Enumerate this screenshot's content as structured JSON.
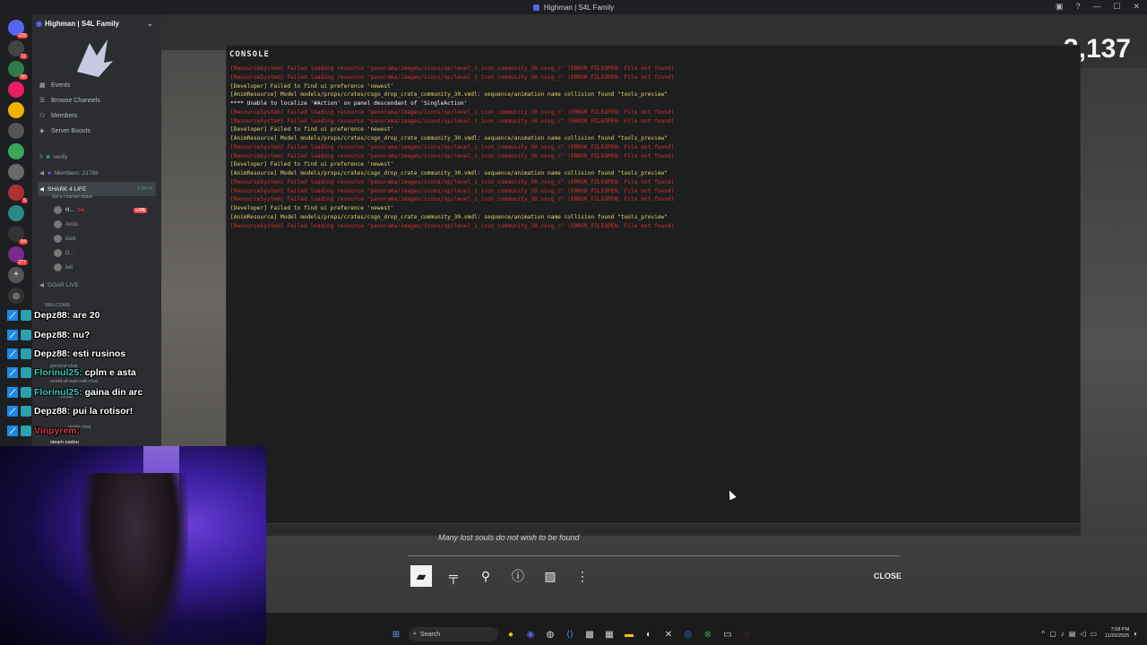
{
  "window": {
    "title": "Highman | S4L Family"
  },
  "game": {
    "counter": "3,137",
    "tagline": "Many lost souls do not wish to be found",
    "close_label": "CLOSE",
    "toolbar_icons": [
      "rifle-icon",
      "pistol-icon",
      "runner-icon",
      "info-icon",
      "image-icon",
      "more-icon"
    ]
  },
  "console": {
    "title": "CONSOLE",
    "lines": [
      {
        "t": "[ResourceSystem] Failed loading resource \"panorama/images/icons/xp/level_1_icon_community_30.vsvg_c\" (ERROR_FILEOPEN: File not found)",
        "c": "red"
      },
      {
        "t": "[ResourceSystem] Failed loading resource \"panorama/images/icons/xp/level_1_icon_community_30.vsvg_c\" (ERROR_FILEOPEN: File not found)",
        "c": "red"
      },
      {
        "t": "[Developer] Failed to find ui preference 'newest'",
        "c": "yellow"
      },
      {
        "t": "[AnimResource] Model models/props/crates/csgo_drop_crate_community_30.vmdl: sequence/animation name collision found \"tools_preview\"",
        "c": "yellow"
      },
      {
        "t": "**** Unable to localize '#Action' on panel descendant of 'SingleAction'",
        "c": "white"
      },
      {
        "t": "[ResourceSystem] Failed loading resource \"panorama/images/icons/xp/level_1_icon_community_30.vsvg_c\" (ERROR_FILEOPEN: File not found)",
        "c": "red"
      },
      {
        "t": "[ResourceSystem] Failed loading resource \"panorama/images/icons/xp/level_1_icon_community_30.vsvg_c\" (ERROR_FILEOPEN: File not found)",
        "c": "red"
      },
      {
        "t": "[Developer] Failed to find ui preference 'newest'",
        "c": "yellow"
      },
      {
        "t": "[AnimResource] Model models/props/crates/csgo_drop_crate_community_30.vmdl: sequence/animation name collision found \"tools_preview\"",
        "c": "yellow"
      },
      {
        "t": "[ResourceSystem] Failed loading resource \"panorama/images/icons/xp/level_1_icon_community_30.vsvg_c\" (ERROR_FILEOPEN: File not found)",
        "c": "red"
      },
      {
        "t": "[ResourceSystem] Failed loading resource \"panorama/images/icons/xp/level_1_icon_community_30.vsvg_c\" (ERROR_FILEOPEN: File not found)",
        "c": "red"
      },
      {
        "t": "[Developer] Failed to find ui preference 'newest'",
        "c": "yellow"
      },
      {
        "t": "[AnimResource] Model models/props/crates/csgo_drop_crate_community_30.vmdl: sequence/animation name collision found \"tools_preview\"",
        "c": "yellow"
      },
      {
        "t": "[ResourceSystem] Failed loading resource \"panorama/images/icons/xp/level_1_icon_community_30.vsvg_c\" (ERROR_FILEOPEN: File not found)",
        "c": "red"
      },
      {
        "t": "[ResourceSystem] Failed loading resource \"panorama/images/icons/xp/level_1_icon_community_30.vsvg_c\" (ERROR_FILEOPEN: File not found)",
        "c": "red"
      },
      {
        "t": "[ResourceSystem] Failed loading resource \"panorama/images/icons/xp/level_1_icon_community_30.vsvg_c\" (ERROR_FILEOPEN: File not found)",
        "c": "red"
      },
      {
        "t": "[Developer] Failed to find ui preference 'newest'",
        "c": "yellow"
      },
      {
        "t": "[AnimResource] Model models/props/crates/csgo_drop_crate_community_30.vmdl: sequence/animation name collision found \"tools_preview\"",
        "c": "yellow"
      },
      {
        "t": "[ResourceSystem] Failed loading resource \"panorama/images/icons/xp/level_1_icon_community_30.vsvg_c\" (ERROR_FILEOPEN: File not found)",
        "c": "red"
      }
    ]
  },
  "discord": {
    "server_name": "Highman | S4L Family",
    "server_badges": [
      "129",
      "11",
      "60",
      "",
      "",
      "",
      "",
      "",
      "5",
      "",
      "",
      "64",
      "277"
    ],
    "menu": [
      {
        "label": "Events",
        "icon": "calendar-icon"
      },
      {
        "label": "Browse Channels",
        "icon": "channels-icon"
      },
      {
        "label": "Members",
        "icon": "members-icon"
      },
      {
        "label": "Server Boosts",
        "icon": "boost-icon"
      }
    ],
    "channels": {
      "verify": "verify",
      "members": "Members: 21766",
      "voice1": "SHARK 4 LIFE",
      "voice1_time": "1:58:04",
      "voice1_status": "Set a channel status",
      "voice_users": [
        "H...",
        "Andu",
        "dark",
        "D...",
        "ket"
      ],
      "voice_user_tag": "S4L",
      "live": "LIVE",
      "voice2": "DOAR LIVE",
      "category": "WELCOME",
      "text_channels": [
        "general-chat",
        "world-of-warcraft-chat",
        "media",
        "mods-chat",
        "steam-cadou"
      ]
    }
  },
  "chat": [
    {
      "user": "Depz88:",
      "msg": "are 20",
      "color": "w"
    },
    {
      "user": "Depz88:",
      "msg": "nu?",
      "color": "w"
    },
    {
      "user": "Depz88:",
      "msg": "esti rusinos",
      "color": "w"
    },
    {
      "user": "Florinul25:",
      "msg": "cplm e asta",
      "color": "g"
    },
    {
      "user": "Florinul25:",
      "msg": "gaina din arc",
      "color": "g"
    },
    {
      "user": "Depz88:",
      "msg": "pui la rotisor!",
      "color": "w"
    },
    {
      "user": "Vinpyrem:",
      "msg": "",
      "color": "r"
    }
  ],
  "taskbar": {
    "search_placeholder": "Search",
    "time": "7:08 PM",
    "date": "11/20/2025"
  }
}
